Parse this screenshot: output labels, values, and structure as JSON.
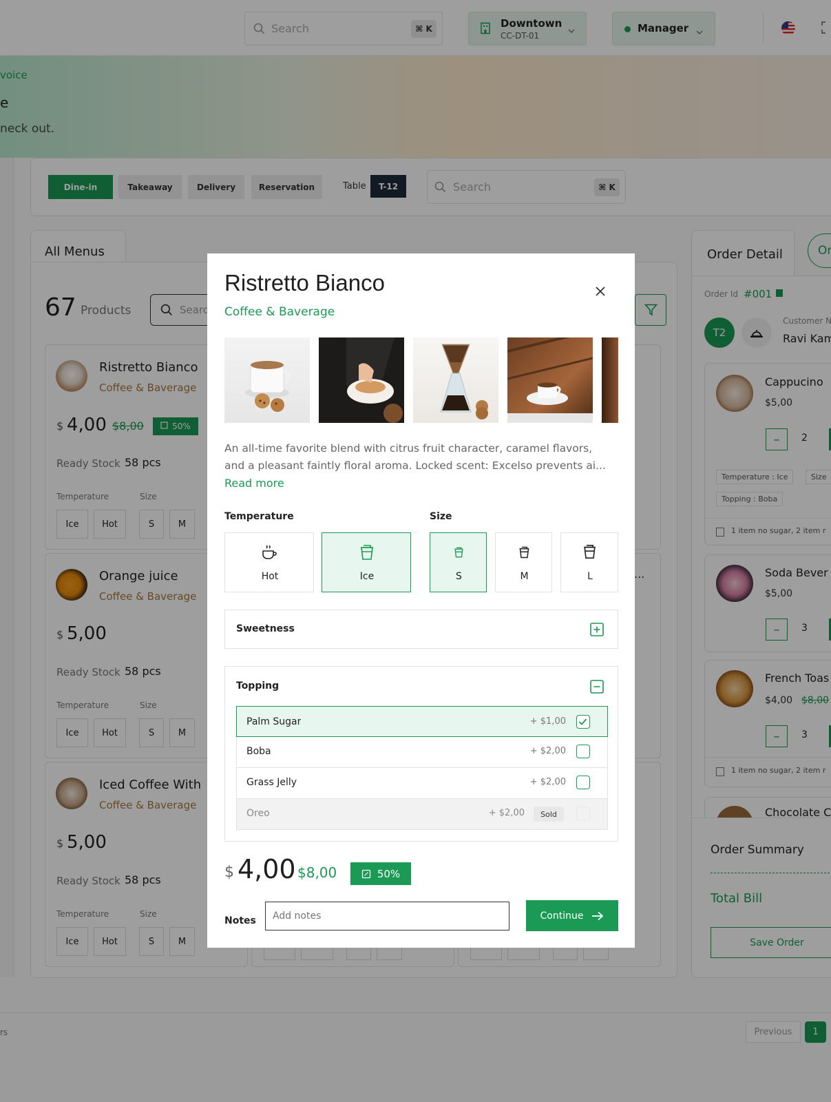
{
  "header": {
    "search_placeholder": "Search",
    "search_shortcut": "⌘ K",
    "branch_name": "Downtown",
    "branch_code": "CC-DT-01",
    "role": "Manager"
  },
  "hero": {
    "breadcrumb": "voice",
    "title": "e",
    "subtitle": "neck out."
  },
  "order_types": {
    "tabs": [
      {
        "label": "Dine-in"
      },
      {
        "label": "Takeaway"
      },
      {
        "label": "Delivery"
      },
      {
        "label": "Reservation"
      }
    ],
    "table_label": "Table",
    "table_value": "T-12",
    "search_placeholder": "Search",
    "search_shortcut": "⌘ K"
  },
  "menus": {
    "tab_label": "All Menus",
    "count": "67",
    "count_label": "Products",
    "search_placeholder": "Searc",
    "products": [
      {
        "name": "Ristretto Bianco",
        "category": "Coffee & Baverage",
        "currency": "$",
        "price": "4,00",
        "old_price": "$8,00",
        "discount": "50%",
        "stock_label": "Ready Stock",
        "stock": "58 pcs",
        "temp_label": "Temperature",
        "size_label": "Size",
        "temps": [
          "Ice",
          "Hot"
        ],
        "sizes": [
          "S",
          "M"
        ]
      },
      {
        "name": "Orange juice",
        "category": "Coffee & Baverage",
        "currency": "$",
        "price": "5,00",
        "stock_label": "Ready Stock",
        "stock": "58 pcs",
        "temp_label": "Temperature",
        "size_label": "Size",
        "temps": [
          "Ice",
          "Hot"
        ],
        "sizes": [
          "S",
          "M"
        ]
      },
      {
        "name": "Iced Coffee With",
        "category": "Coffee & Baverage",
        "currency": "$",
        "price": "5,00",
        "stock_label": "Ready Stock",
        "stock": "58 pcs",
        "temp_label": "Temperature",
        "size_label": "Size",
        "temps": [
          "Ice",
          "Hot"
        ],
        "sizes": [
          "S",
          "M"
        ]
      }
    ],
    "more_dots": "..."
  },
  "order_detail": {
    "title": "Order Detail",
    "tab_partial": "Or",
    "order_id_label": "Order Id",
    "order_id": "#001",
    "table_badge": "T2",
    "customer_label": "Customer N",
    "customer_name": "Ravi Kam",
    "items": [
      {
        "name": "Cappucino",
        "price": "$5,00",
        "qty": "2",
        "tags": [
          "Temperature : Ice",
          "Size",
          "Topping : Boba"
        ],
        "note": "1 item no sugar, 2 item r"
      },
      {
        "name": "Soda Bever",
        "price": "$5,00",
        "qty": "3"
      },
      {
        "name": "French Toas",
        "price": "$4,00",
        "old_price": "$8,00",
        "qty": "3",
        "note": "1 item no sugar, 2 item r"
      },
      {
        "name": "Chocolate C"
      }
    ],
    "summary_title": "Order Summary",
    "total_label": "Total Bill",
    "save_label": "Save Order"
  },
  "pagination": {
    "left_text": "rs",
    "previous": "Previous",
    "current": "1"
  },
  "modal": {
    "title": "Ristretto Bianco",
    "category": "Coffee & Baverage",
    "description_line1": "An all-time favorite blend with citrus fruit character, caramel flavors,",
    "description_line2": "and a pleasant faintly floral aroma. Locked scent: Excelso prevents ai...",
    "read_more": "Read more",
    "temperature_label": "Temperature",
    "temperature_options": [
      {
        "label": "Hot",
        "icon": "hot-cup-icon",
        "selected": false
      },
      {
        "label": "Ice",
        "icon": "iced-cup-icon",
        "selected": true
      }
    ],
    "size_label": "Size",
    "size_options": [
      {
        "label": "S",
        "selected": true
      },
      {
        "label": "M",
        "selected": false
      },
      {
        "label": "L",
        "selected": false
      }
    ],
    "sweetness_label": "Sweetness",
    "topping_label": "Topping",
    "toppings": [
      {
        "name": "Palm Sugar",
        "price": "+ $1,00",
        "checked": true
      },
      {
        "name": "Boba",
        "price": "+ $2,00",
        "checked": false
      },
      {
        "name": "Grass Jelly",
        "price": "+ $2,00",
        "checked": false
      },
      {
        "name": "Oreo",
        "price": "+ $2,00",
        "sold": "Sold"
      }
    ],
    "currency": "$",
    "price": "4,00",
    "old_price": "$8,00",
    "discount": "50%",
    "notes_label": "Notes",
    "notes_placeholder": "Add notes",
    "continue_label": "Continue"
  },
  "colors": {
    "accent": "#1a9a55",
    "category": "#a8763e",
    "overlay": "#000000"
  }
}
